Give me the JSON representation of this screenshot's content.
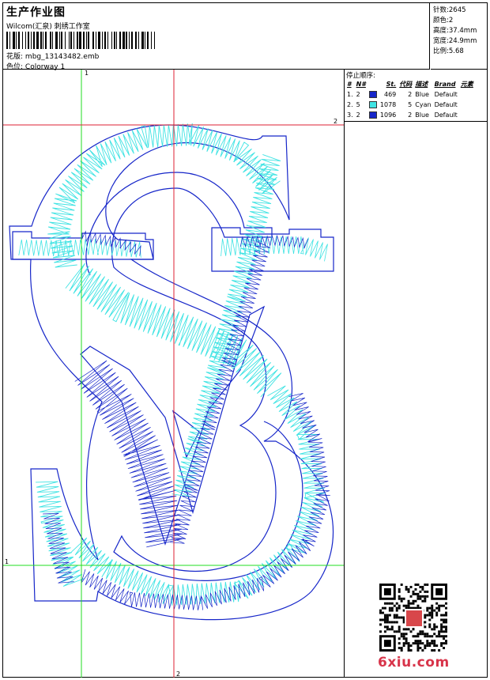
{
  "header": {
    "title": "生产作业图",
    "company": "Wilcom(汇泉) 刺绣工作室",
    "file_label": "花版:",
    "file_name": "mbg_13143482.emb",
    "colorway_label": "色位:",
    "colorway_name": "Colorway 1"
  },
  "stats": [
    {
      "label": "针数:",
      "value": "2645"
    },
    {
      "label": "颜色:",
      "value": "2"
    },
    {
      "label": "高度:",
      "value": "37.4mm"
    },
    {
      "label": "宽度:",
      "value": "24.9mm"
    },
    {
      "label": "比例:",
      "value": "5.68"
    }
  ],
  "stop_sequence": {
    "title": "停止顺序:",
    "headers": [
      "#",
      "N#",
      "St.",
      "代码",
      "描述",
      "Brand",
      "元素"
    ],
    "rows": [
      {
        "num": "1.",
        "needle": "2",
        "color": "#1626c9",
        "stitches": "469",
        "code": "2",
        "desc": "Blue",
        "brand": "Default"
      },
      {
        "num": "2.",
        "needle": "5",
        "color": "#3fe3e3",
        "stitches": "1078",
        "code": "5",
        "desc": "Cyan",
        "brand": "Default"
      },
      {
        "num": "3.",
        "needle": "2",
        "color": "#1626c9",
        "stitches": "1096",
        "code": "2",
        "desc": "Blue",
        "brand": "Default"
      }
    ]
  },
  "guides": {
    "green_label_top": "1",
    "green_label_left": "1",
    "red_label_right": "2",
    "red_label_bottom": "2"
  },
  "colors": {
    "blue": "#1626c9",
    "cyan": "#3fe3e3",
    "guide_green": "#22dd22",
    "guide_red": "#dd2233"
  },
  "watermark": "6xiu.com"
}
